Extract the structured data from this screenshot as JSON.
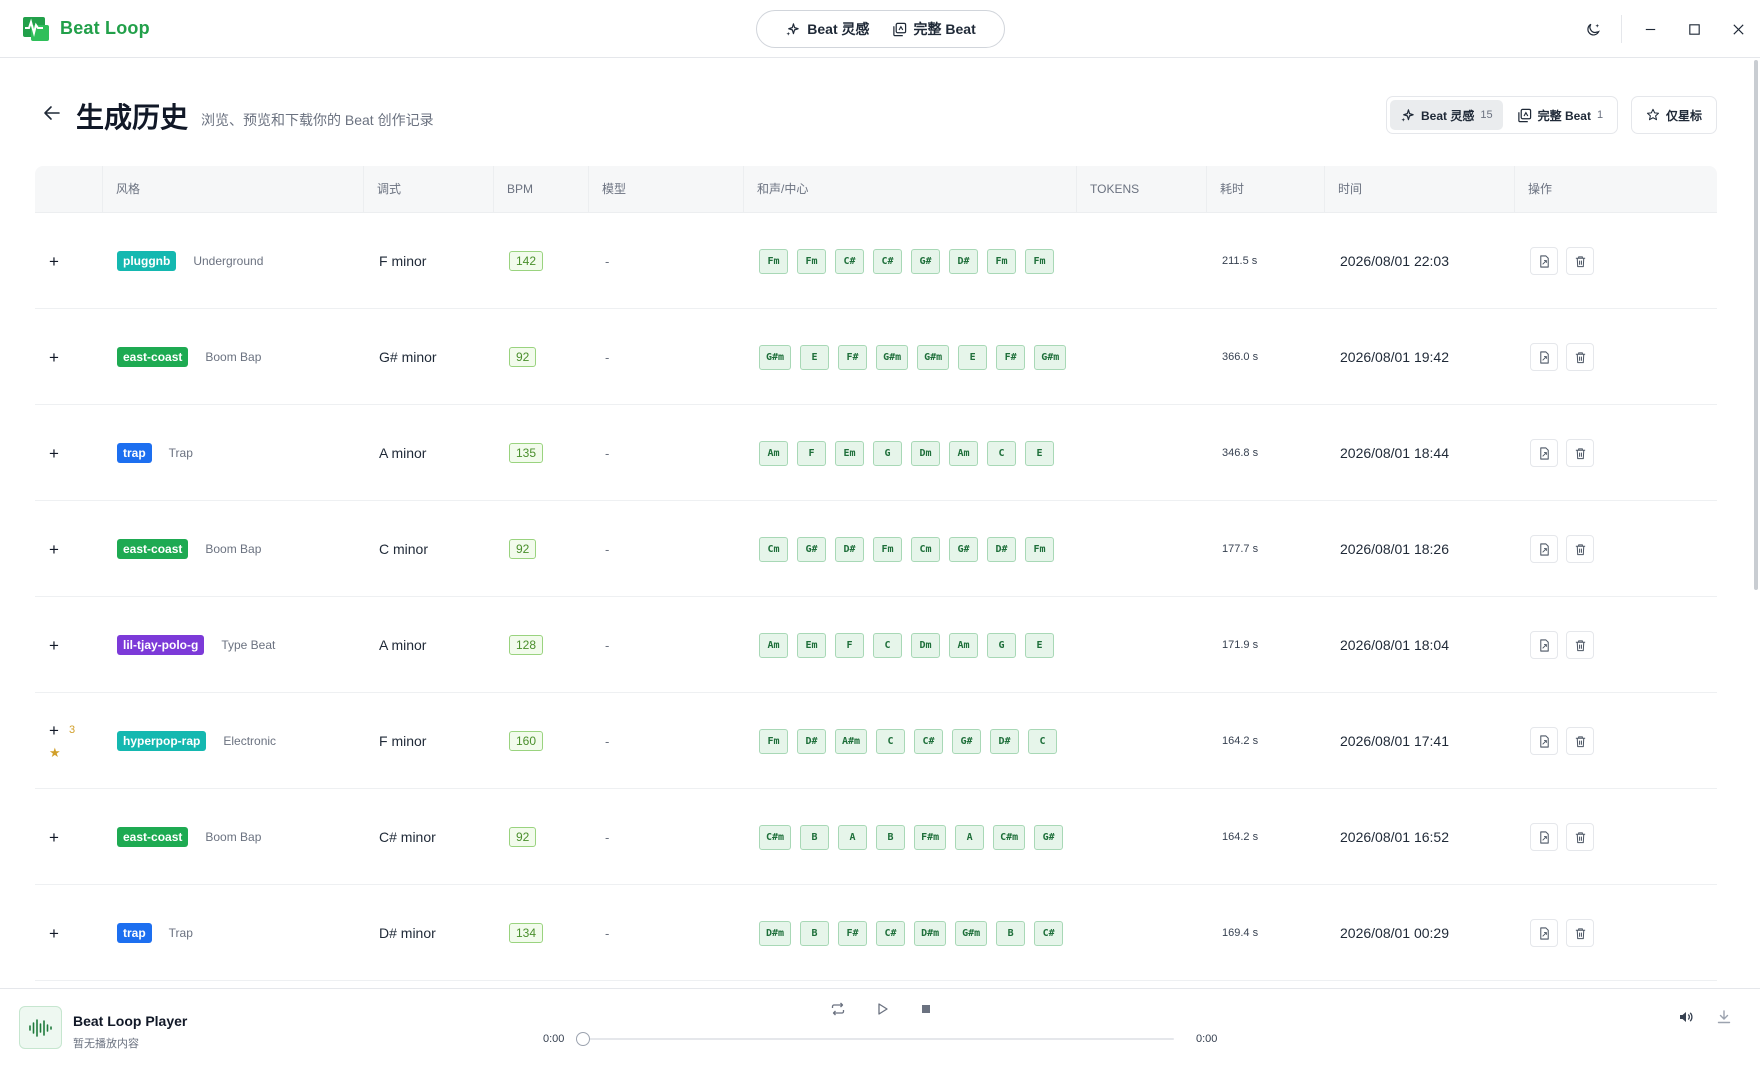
{
  "app": {
    "name": "Beat Loop",
    "colors": {
      "brand": "#22a04a",
      "star": "#d19f2a",
      "chord_bg": "#e6f5ea",
      "bpm_text": "#4a8f2c"
    }
  },
  "titlebar": {
    "modes": [
      {
        "label": "Beat 灵感",
        "icon": "sparkle-icon"
      },
      {
        "label": "完整 Beat",
        "icon": "layers-icon"
      }
    ],
    "icons": [
      "moon-icon",
      "minimize-icon",
      "maximize-icon",
      "close-icon"
    ]
  },
  "header": {
    "title": "生成历史",
    "subtitle": "浏览、预览和下载你的 Beat 创作记录",
    "filters": [
      {
        "label": "Beat 灵感",
        "count": "15",
        "active": true
      },
      {
        "label": "完整 Beat",
        "count": "1",
        "active": false
      }
    ],
    "star_filter": "仅星标"
  },
  "table": {
    "columns": [
      "风格",
      "调式",
      "BPM",
      "模型",
      "和声/中心",
      "TOKENS",
      "耗时",
      "时间",
      "操作"
    ],
    "rows": [
      {
        "style": "pluggnb",
        "style_color": "#14b8b0",
        "genre": "Underground",
        "key": "F minor",
        "bpm": "142",
        "model": "-",
        "chords": [
          "Fm",
          "Fm",
          "C#",
          "C#",
          "G#",
          "D#",
          "Fm",
          "Fm"
        ],
        "duration": "211.5 s",
        "time": "2026/08/01 22:03",
        "stars": "",
        "starred": false
      },
      {
        "style": "east-coast",
        "style_color": "#1eaa52",
        "genre": "Boom Bap",
        "key": "G# minor",
        "bpm": "92",
        "model": "-",
        "chords": [
          "G#m",
          "E",
          "F#",
          "G#m",
          "G#m",
          "E",
          "F#",
          "G#m"
        ],
        "duration": "366.0 s",
        "time": "2026/08/01 19:42",
        "stars": "",
        "starred": false
      },
      {
        "style": "trap",
        "style_color": "#1d6ff0",
        "genre": "Trap",
        "key": "A minor",
        "bpm": "135",
        "model": "-",
        "chords": [
          "Am",
          "F",
          "Em",
          "G",
          "Dm",
          "Am",
          "C",
          "E"
        ],
        "duration": "346.8 s",
        "time": "2026/08/01 18:44",
        "stars": "",
        "starred": false
      },
      {
        "style": "east-coast",
        "style_color": "#1eaa52",
        "genre": "Boom Bap",
        "key": "C minor",
        "bpm": "92",
        "model": "-",
        "chords": [
          "Cm",
          "G#",
          "D#",
          "Fm",
          "Cm",
          "G#",
          "D#",
          "Fm"
        ],
        "duration": "177.7 s",
        "time": "2026/08/01 18:26",
        "stars": "",
        "starred": false
      },
      {
        "style": "lil-tjay-polo-g",
        "style_color": "#7c3ad8",
        "genre": "Type Beat",
        "key": "A minor",
        "bpm": "128",
        "model": "-",
        "chords": [
          "Am",
          "Em",
          "F",
          "C",
          "Dm",
          "Am",
          "G",
          "E"
        ],
        "duration": "171.9 s",
        "time": "2026/08/01 18:04",
        "stars": "",
        "starred": false
      },
      {
        "style": "hyperpop-rap",
        "style_color": "#14b8b0",
        "genre": "Electronic",
        "key": "F minor",
        "bpm": "160",
        "model": "-",
        "chords": [
          "Fm",
          "D#",
          "A#m",
          "C",
          "C#",
          "G#",
          "D#",
          "C"
        ],
        "duration": "164.2 s",
        "time": "2026/08/01 17:41",
        "stars": "3",
        "starred": true
      },
      {
        "style": "east-coast",
        "style_color": "#1eaa52",
        "genre": "Boom Bap",
        "key": "C# minor",
        "bpm": "92",
        "model": "-",
        "chords": [
          "C#m",
          "B",
          "A",
          "B",
          "F#m",
          "A",
          "C#m",
          "G#"
        ],
        "duration": "164.2 s",
        "time": "2026/08/01 16:52",
        "stars": "",
        "starred": false
      },
      {
        "style": "trap",
        "style_color": "#1d6ff0",
        "genre": "Trap",
        "key": "D# minor",
        "bpm": "134",
        "model": "-",
        "chords": [
          "D#m",
          "B",
          "F#",
          "C#",
          "D#m",
          "G#m",
          "B",
          "C#"
        ],
        "duration": "169.4 s",
        "time": "2026/08/01 00:29",
        "stars": "",
        "starred": false
      }
    ]
  },
  "player": {
    "title": "Beat Loop Player",
    "subtitle": "暂无播放内容",
    "time_current": "0:00",
    "time_total": "0:00",
    "progress": 0
  }
}
